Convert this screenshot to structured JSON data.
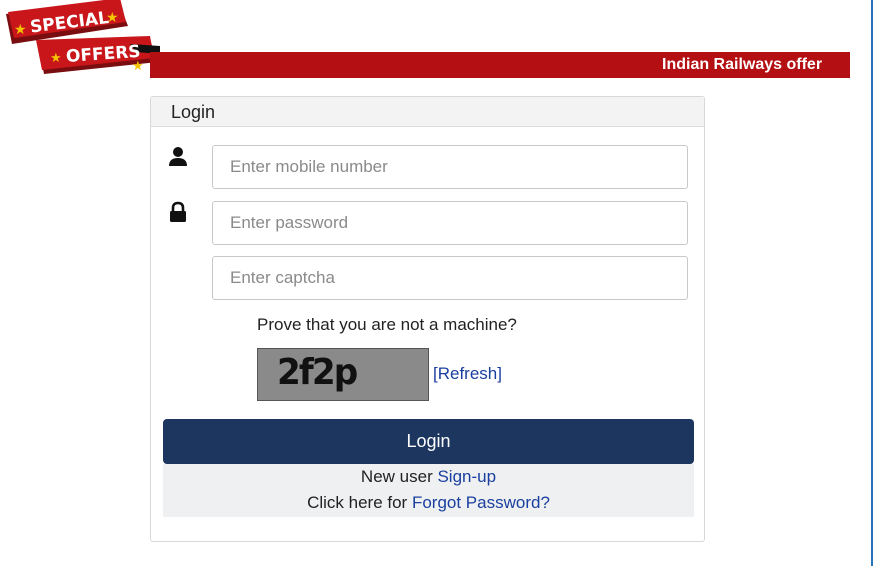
{
  "promo": {
    "badge_line1": "SPECIAL",
    "badge_line2": "OFFERS",
    "banner_text": "Indian Railways offer",
    "banner_color": "#b40f12"
  },
  "login": {
    "title": "Login",
    "mobile_placeholder": "Enter mobile number",
    "password_placeholder": "Enter password",
    "captcha_placeholder": "Enter captcha",
    "prove_text": "Prove that you are not a machine?",
    "captcha_value": "2f2p",
    "refresh_label": "[Refresh]",
    "button_label": "Login",
    "button_color": "#1c3660",
    "new_user_prefix": "New user ",
    "signup_label": "Sign-up",
    "forgot_prefix": "Click here for ",
    "forgot_label": "Forgot Password?",
    "link_color": "#1a3fa0"
  },
  "icons": {
    "mobile_field": "user-icon",
    "password_field": "lock-icon"
  }
}
